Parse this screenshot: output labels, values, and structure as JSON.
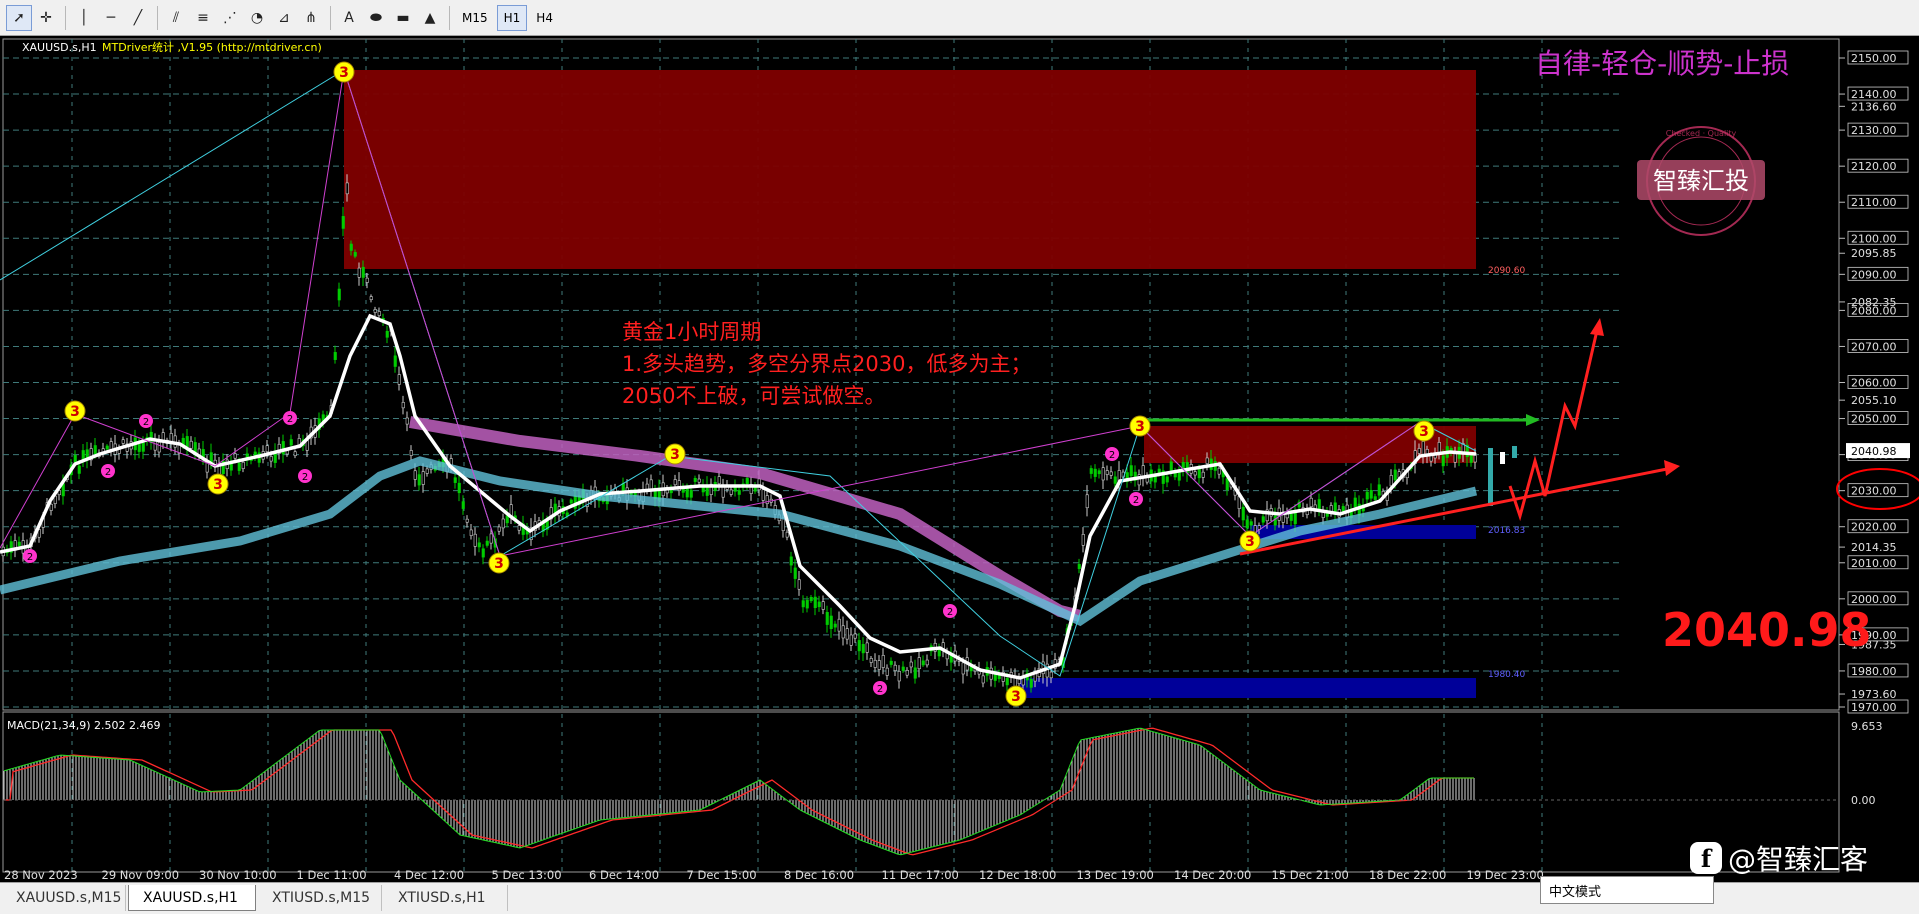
{
  "toolbar": {
    "tools": [
      {
        "name": "cursor-icon",
        "glyph": "➚"
      },
      {
        "name": "crosshair-icon",
        "glyph": "✛"
      },
      {
        "name": "vertical-line-icon",
        "glyph": "│"
      },
      {
        "name": "horizontal-line-icon",
        "glyph": "─"
      },
      {
        "name": "trendline-icon",
        "glyph": "╱"
      },
      {
        "name": "channel-icon",
        "glyph": "⫽"
      },
      {
        "name": "fibo-retracement-icon",
        "glyph": "≡"
      },
      {
        "name": "fibo-fan-icon",
        "glyph": "⋰"
      },
      {
        "name": "fibo-arc-icon",
        "glyph": "◔"
      },
      {
        "name": "gann-icon",
        "glyph": "⊿"
      },
      {
        "name": "pitchfork-icon",
        "glyph": "⋔"
      },
      {
        "name": "text-icon",
        "glyph": "A"
      },
      {
        "name": "ellipse-icon",
        "glyph": "⬬"
      },
      {
        "name": "rectangle-icon",
        "glyph": "▬"
      },
      {
        "name": "triangle-icon",
        "glyph": "▲"
      }
    ],
    "timeframes": [
      "M15",
      "H1",
      "H4"
    ],
    "active_timeframe": "H1"
  },
  "chart": {
    "symbol_header": "XAUUSD.s,H1",
    "indicator_label": "MTDriver统计 ,V1.95 (http://mtdriver.cn)",
    "slogan": "自律-轻仓-顺势-止损",
    "seal_text": "智臻汇投",
    "seal_ring_text": "Checked · Quality",
    "big_price": "2040.98",
    "annotation": {
      "line1": "黄金1小时周期",
      "line2": "1.多头趋势，多空分界点2030，低多为主；",
      "line3": "2050不上破，可尝试做空。"
    },
    "zone_labels": [
      "2090.60",
      "2016.83",
      "1980.40"
    ],
    "current_tag": "2040.98",
    "price_axis": [
      "2150.00",
      "2140.00",
      "2136.60",
      "2130.00",
      "2120.00",
      "2110.00",
      "2100.00",
      "2095.85",
      "2090.00",
      "2082.35",
      "2080.00",
      "2070.00",
      "2060.00",
      "2055.10",
      "2050.00",
      "2040.00",
      "2030.00",
      "2020.00",
      "2014.35",
      "2010.00",
      "2000.00",
      "1990.00",
      "1987.35",
      "1980.00",
      "1973.60",
      "1970.00"
    ],
    "time_axis": [
      "28 Nov 2023",
      "29 Nov 09:00",
      "30 Nov 10:00",
      "1 Dec 11:00",
      "4 Dec 12:00",
      "5 Dec 13:00",
      "6 Dec 14:00",
      "7 Dec 15:00",
      "8 Dec 16:00",
      "11 Dec 17:00",
      "12 Dec 18:00",
      "13 Dec 19:00",
      "14 Dec 20:00",
      "15 Dec 21:00",
      "18 Dec 22:00",
      "19 Dec 23:00"
    ],
    "macd_label": "MACD(21,34,9) 2.502 2.469",
    "macd_axis": [
      "9.653",
      "0.00"
    ],
    "wave_badge": "3",
    "pivot_badge": "2"
  },
  "tabs": [
    "XAUUSD.s,M15",
    "XAUUSD.s,H1",
    "XTIUSD.s,M15",
    "XTIUSD.s,H1"
  ],
  "active_tab": "XAUUSD.s,H1",
  "ime": "中文模式",
  "watermark": "@智臻汇客",
  "colors": {
    "zone_red": "#7f0000",
    "zone_blue": "#000099",
    "slogan": "#cc33cc",
    "annotation": "#ff2020",
    "big_price": "#ff1a1a",
    "grid": "#3a6a6a",
    "candle_up": "#00cc00",
    "ma": "#ffffff",
    "macd_signal": "#ff2a2a"
  }
}
